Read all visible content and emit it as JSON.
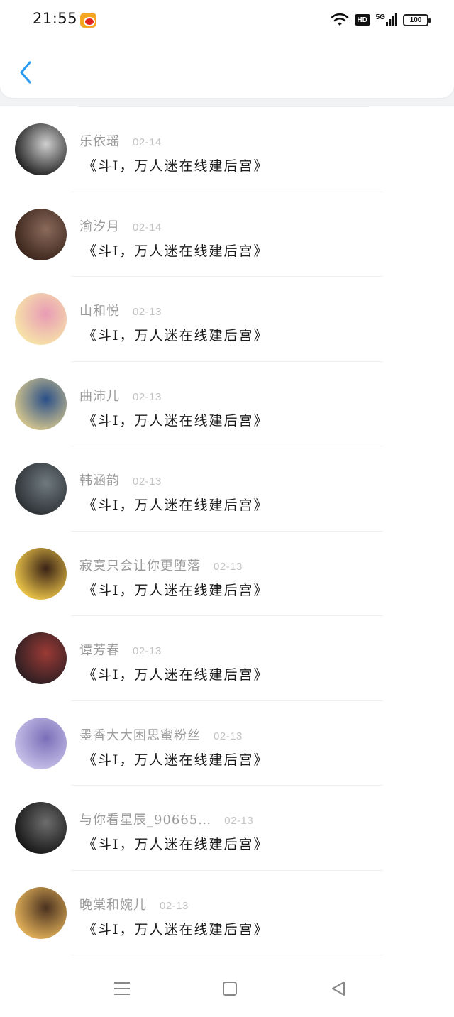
{
  "status_bar": {
    "time": "21:55",
    "network_label": "5G",
    "hd_label": "HD",
    "battery": "100"
  },
  "nav": {
    "back_icon": "chevron-left-icon",
    "accent": "#2d9cf0"
  },
  "items": [
    {
      "name": "乐依瑶",
      "date": "02-14",
      "message": "《斗I，万人迷在线建后宫》",
      "avatar_colors": [
        "#1d1d1d",
        "#cfcfcf"
      ]
    },
    {
      "name": "渝汐月",
      "date": "02-14",
      "message": "《斗I，万人迷在线建后宫》",
      "avatar_colors": [
        "#3a241b",
        "#8a6a5a"
      ]
    },
    {
      "name": "山和悦",
      "date": "02-13",
      "message": "《斗I，万人迷在线建后宫》",
      "avatar_colors": [
        "#f7e6a8",
        "#e89bb5"
      ]
    },
    {
      "name": "曲沛儿",
      "date": "02-13",
      "message": "《斗I，万人迷在线建后宫》",
      "avatar_colors": [
        "#d9c98e",
        "#2a4f88"
      ]
    },
    {
      "name": "韩涵韵",
      "date": "02-13",
      "message": "《斗I，万人迷在线建后宫》",
      "avatar_colors": [
        "#2b2f33",
        "#6f7a7f"
      ]
    },
    {
      "name": "寂寞只会让你更堕落",
      "date": "02-13",
      "message": "《斗I，万人迷在线建后宫》",
      "avatar_colors": [
        "#f1c94a",
        "#3a2316"
      ]
    },
    {
      "name": "谭芳春",
      "date": "02-13",
      "message": "《斗I，万人迷在线建后宫》",
      "avatar_colors": [
        "#2a1e22",
        "#9b3a35"
      ]
    },
    {
      "name": "墨香大大困思蜜粉丝",
      "date": "02-13",
      "message": "《斗I，万人迷在线建后宫》",
      "avatar_colors": [
        "#c9c3ea",
        "#7a6fb8"
      ]
    },
    {
      "name": "与你看星辰_90665…",
      "date": "02-13",
      "message": "《斗I，万人迷在线建后宫》",
      "avatar_colors": [
        "#141414",
        "#6d6d6d"
      ]
    },
    {
      "name": "晚棠和婉儿",
      "date": "02-13",
      "message": "《斗I，万人迷在线建后宫》",
      "avatar_colors": [
        "#e6b45a",
        "#4b3220"
      ]
    }
  ],
  "bottom_nav": {
    "menu_icon": "menu-lines-icon",
    "home_icon": "home-square-icon",
    "back_icon": "back-triangle-icon"
  }
}
